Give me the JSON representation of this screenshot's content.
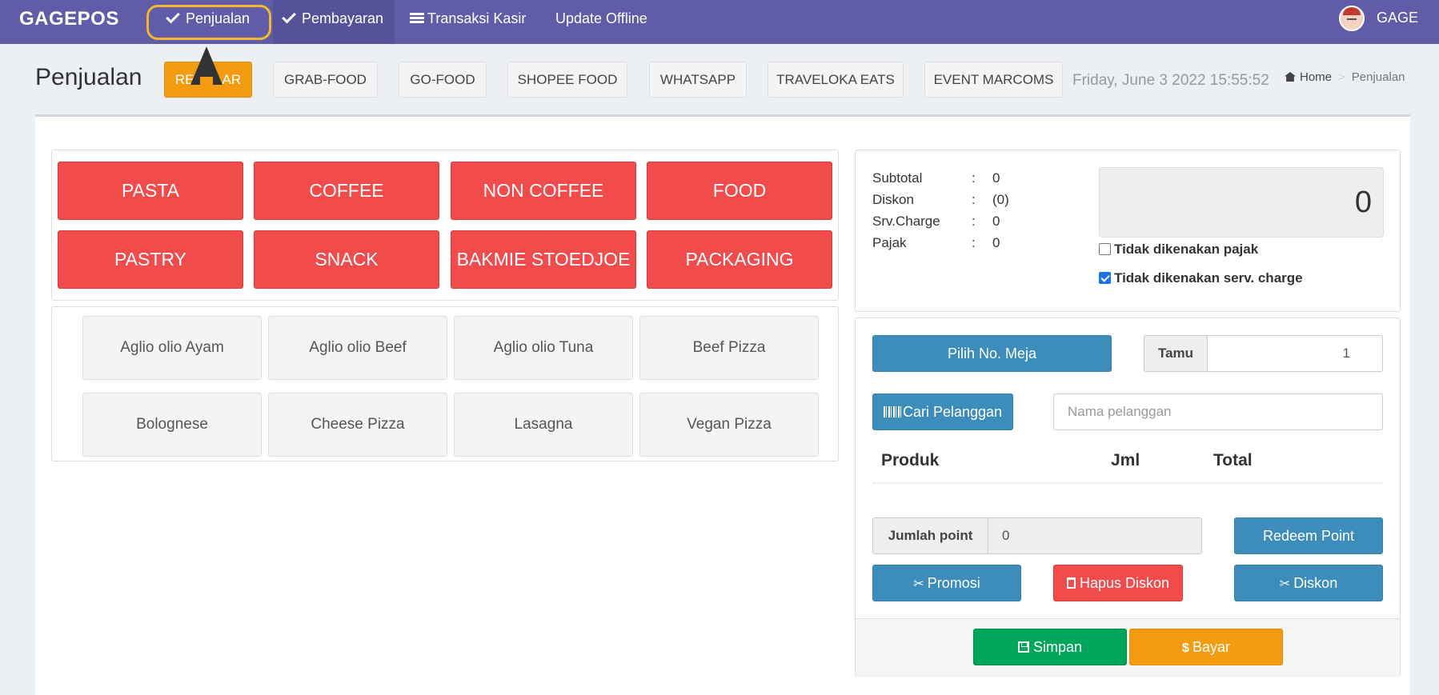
{
  "nav": {
    "brand": "GAGEPOS",
    "items": [
      {
        "label": "Penjualan"
      },
      {
        "label": "Pembayaran"
      },
      {
        "label": "Transaksi Kasir"
      },
      {
        "label": "Update Offline"
      }
    ],
    "user": "GAGE"
  },
  "header": {
    "title": "Penjualan",
    "tabs": [
      "REGULAR",
      "GRAB-FOOD",
      "GO-FOOD",
      "SHOPEE FOOD",
      "WHATSAPP",
      "TRAVELOKA EATS",
      "EVENT MARCOMS"
    ],
    "datetime": "Friday, June 3 2022 15:55:52",
    "breadcrumb": {
      "home": "Home",
      "current": "Penjualan"
    }
  },
  "categories": [
    "PASTA",
    "COFFEE",
    "NON COFFEE",
    "FOOD",
    "PASTRY",
    "SNACK",
    "BAKMIE STOEDJOE",
    "PACKAGING"
  ],
  "products": [
    "Aglio olio Ayam",
    "Aglio olio Beef",
    "Aglio olio Tuna",
    "Beef Pizza",
    "Bolognese",
    "Cheese Pizza",
    "Lasagna",
    "Vegan Pizza"
  ],
  "summary": {
    "rows": [
      {
        "label": "Subtotal",
        "value": "0"
      },
      {
        "label": "Diskon",
        "value": "(0)"
      },
      {
        "label": "Srv.Charge",
        "value": "0"
      },
      {
        "label": "Pajak",
        "value": "0"
      }
    ],
    "colon": ":",
    "total": "0",
    "no_tax_label": "Tidak dikenakan pajak",
    "no_tax_checked": false,
    "no_service_label": "Tidak dikenakan serv. charge",
    "no_service_checked": true
  },
  "order": {
    "table_button": "Pilih No. Meja",
    "guest_label": "Tamu",
    "guest_value": "1",
    "customer_button": "Cari Pelanggan",
    "customer_placeholder": "Nama pelanggan",
    "columns": [
      "Produk",
      "Jml",
      "Total"
    ],
    "points_label": "Jumlah point",
    "points_value": "0",
    "redeem_button": "Redeem Point",
    "promo_button": "Promosi",
    "remove_discount_button": "Hapus Diskon",
    "discount_button": "Diskon",
    "save_button": "Simpan",
    "pay_button": "Bayar"
  },
  "colors": {
    "nav": "#605ca8",
    "category": "#f14b4b",
    "primary": "#3c8dbc",
    "success": "#00a65a",
    "warning": "#f39c12"
  }
}
